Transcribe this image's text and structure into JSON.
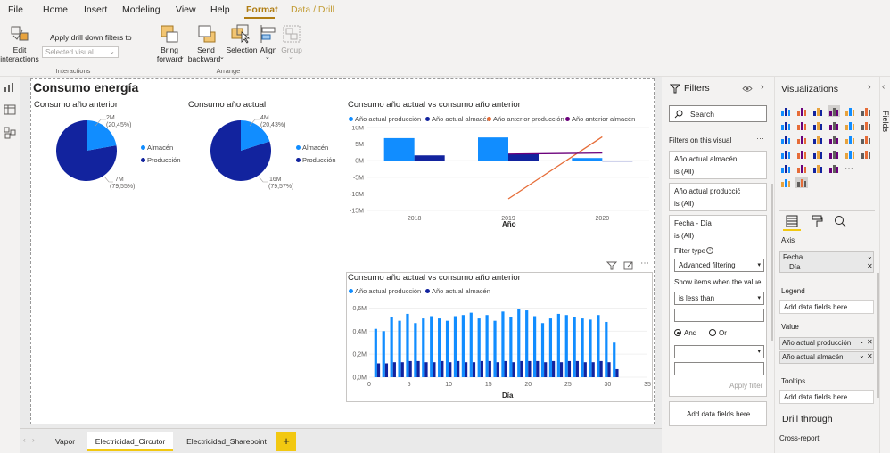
{
  "menu": {
    "items": [
      "File",
      "Home",
      "Insert",
      "Modeling",
      "View",
      "Help",
      "Format",
      "Data / Drill"
    ]
  },
  "ribbon": {
    "edit_interactions_line1": "Edit",
    "edit_interactions_line2": "interactions",
    "apply_drill_label": "Apply drill down filters to",
    "apply_drill_placeholder": "Selected visual",
    "interactions_group": "Interactions",
    "bring_forward_line1": "Bring",
    "bring_forward_line2": "forward",
    "send_backward_line1": "Send",
    "send_backward_line2": "backward",
    "selection_label": "Selection",
    "align_label": "Align",
    "group_label": "Group",
    "arrange_group": "Arrange"
  },
  "page_title": "Consumo energía",
  "pie1": {
    "title": "Consumo año anterior",
    "label_small_value": "2M",
    "label_small_pct": "(20,45%)",
    "label_large_value": "7M",
    "label_large_pct": "(79,55%)",
    "legend": [
      "Almacén",
      "Producción"
    ]
  },
  "pie2": {
    "title": "Consumo año actual",
    "label_small_value": "4M",
    "label_small_pct": "(20,43%)",
    "label_large_value": "16M",
    "label_large_pct": "(79,57%)",
    "legend": [
      "Almacén",
      "Producción"
    ]
  },
  "combo": {
    "title": "Consumo año actual vs consumo año anterior",
    "legend": [
      "Año actual producción",
      "Año actual almacén",
      "Año anterior producción",
      "Año anterior almacén"
    ],
    "xlabel": "Año"
  },
  "daily": {
    "title": "Consumo año actual vs consumo año anterior",
    "legend": [
      "Año actual producción",
      "Año actual almacén"
    ],
    "xlabel": "Día"
  },
  "chart_data": [
    {
      "type": "pie",
      "title": "Consumo año anterior",
      "categories": [
        "Almacén",
        "Producción"
      ],
      "values": [
        2,
        7
      ],
      "percentages": [
        "20,45%",
        "79,55%"
      ],
      "unit": "M",
      "legend": "right",
      "colors": [
        "#118dff",
        "#12239e"
      ]
    },
    {
      "type": "pie",
      "title": "Consumo año actual",
      "categories": [
        "Almacén",
        "Producción"
      ],
      "values": [
        4,
        16
      ],
      "percentages": [
        "20,43%",
        "79,57%"
      ],
      "unit": "M",
      "legend": "right",
      "colors": [
        "#118dff",
        "#12239e"
      ]
    },
    {
      "type": "bar",
      "title": "Consumo año actual vs consumo año anterior",
      "categories": [
        "2018",
        "2019",
        "2020"
      ],
      "xlabel": "Año",
      "ylabel": "",
      "ylim": [
        -15,
        10
      ],
      "yticks": [
        "10M",
        "5M",
        "0M",
        "-5M",
        "-10M",
        "-15M"
      ],
      "legend": "top-left",
      "series": [
        {
          "name": "Año actual producción",
          "kind": "bar",
          "color": "#118dff",
          "values": [
            6.8,
            7.0,
            0.8
          ]
        },
        {
          "name": "Año actual almacén",
          "kind": "bar",
          "color": "#12239e",
          "values": [
            1.6,
            2.0,
            -0.1
          ]
        },
        {
          "name": "Año anterior producción",
          "kind": "line",
          "color": "#e66c37",
          "values": [
            null,
            -11.5,
            7.2
          ]
        },
        {
          "name": "Año anterior almacén",
          "kind": "line",
          "color": "#6b007b",
          "values": [
            null,
            2.0,
            2.3
          ]
        }
      ]
    },
    {
      "type": "bar",
      "title": "Consumo año actual vs consumo año anterior",
      "xlabel": "Día",
      "ylabel": "",
      "ylim": [
        0,
        0.65
      ],
      "yticks": [
        "0,6M",
        "0,4M",
        "0,2M",
        "0,0M"
      ],
      "xticks": [
        0,
        5,
        10,
        15,
        20,
        25,
        30,
        35
      ],
      "legend": "top-left",
      "x": [
        1,
        2,
        3,
        4,
        5,
        6,
        7,
        8,
        9,
        10,
        11,
        12,
        13,
        14,
        15,
        16,
        17,
        18,
        19,
        20,
        21,
        22,
        23,
        24,
        25,
        26,
        27,
        28,
        29,
        30,
        31
      ],
      "series": [
        {
          "name": "Año actual producción",
          "color": "#118dff",
          "values": [
            0.42,
            0.4,
            0.52,
            0.49,
            0.55,
            0.47,
            0.51,
            0.53,
            0.51,
            0.49,
            0.53,
            0.54,
            0.56,
            0.51,
            0.54,
            0.49,
            0.57,
            0.52,
            0.59,
            0.58,
            0.53,
            0.47,
            0.51,
            0.55,
            0.54,
            0.52,
            0.51,
            0.5,
            0.54,
            0.48,
            0.3
          ]
        },
        {
          "name": "Año actual almacén",
          "color": "#12239e",
          "values": [
            0.12,
            0.12,
            0.13,
            0.13,
            0.14,
            0.14,
            0.13,
            0.13,
            0.14,
            0.13,
            0.14,
            0.13,
            0.13,
            0.14,
            0.14,
            0.13,
            0.14,
            0.13,
            0.14,
            0.14,
            0.14,
            0.13,
            0.14,
            0.13,
            0.14,
            0.14,
            0.13,
            0.13,
            0.14,
            0.13,
            0.07
          ]
        }
      ]
    }
  ],
  "filters": {
    "title": "Filters",
    "search_placeholder": "Search",
    "section": "Filters on this visual",
    "card1_name": "Año actual almacén",
    "card1_value": "is (All)",
    "card2_name": "Año actual produccić",
    "card2_value": "is (All)",
    "card3_name": "Fecha - Día",
    "card3_value": "is (All)",
    "filter_type_label": "Filter type",
    "filter_type_value": "Advanced filtering",
    "show_items_label": "Show items when the value:",
    "condition_value": "is less than",
    "and_label": "And",
    "or_label": "Or",
    "apply_filter": "Apply filter",
    "add_data_fields": "Add data fields here"
  },
  "visualizations": {
    "title": "Visualizations",
    "axis_label": "Axis",
    "axis_field1": "Fecha",
    "axis_field2": "Día",
    "legend_label": "Legend",
    "legend_placeholder": "Add data fields here",
    "values_label": "Value",
    "value_field1": "Año actual producción",
    "value_field2": "Año actual almacén",
    "tooltips_label": "Tooltips",
    "tooltips_placeholder": "Add data fields here",
    "drill_through": "Drill through",
    "cross_report": "Cross-report"
  },
  "fields_strip_label": "Fields",
  "tabs": [
    "Vapor",
    "Electricidad_Circutor",
    "Electricidad_Sharepoint"
  ],
  "add_tab_label": "+"
}
